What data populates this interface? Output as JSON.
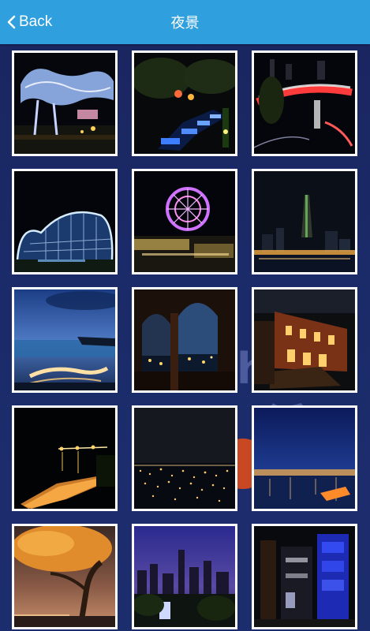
{
  "navbar": {
    "back_label": "Back",
    "back_icon": "chevron-left-icon",
    "title": "夜景"
  },
  "colors": {
    "navbar": "#2f9fdd",
    "background": "#1b2a63",
    "tile_border": "#ffffff"
  },
  "gallery": {
    "photos": [
      {
        "name": "photo-light-sculpture"
      },
      {
        "name": "photo-blue-lit-walkway"
      },
      {
        "name": "photo-red-bridge"
      },
      {
        "name": "photo-dome-structure"
      },
      {
        "name": "photo-ferris-wheel"
      },
      {
        "name": "photo-city-skyline-tower"
      },
      {
        "name": "photo-harbor-dusk"
      },
      {
        "name": "photo-arched-window-view"
      },
      {
        "name": "photo-brick-building"
      },
      {
        "name": "photo-pier-lights"
      },
      {
        "name": "photo-city-lights-panorama"
      },
      {
        "name": "photo-harbor-night"
      },
      {
        "name": "photo-tree-sunset"
      },
      {
        "name": "photo-city-twilight"
      },
      {
        "name": "photo-blue-lit-buildings"
      }
    ]
  }
}
